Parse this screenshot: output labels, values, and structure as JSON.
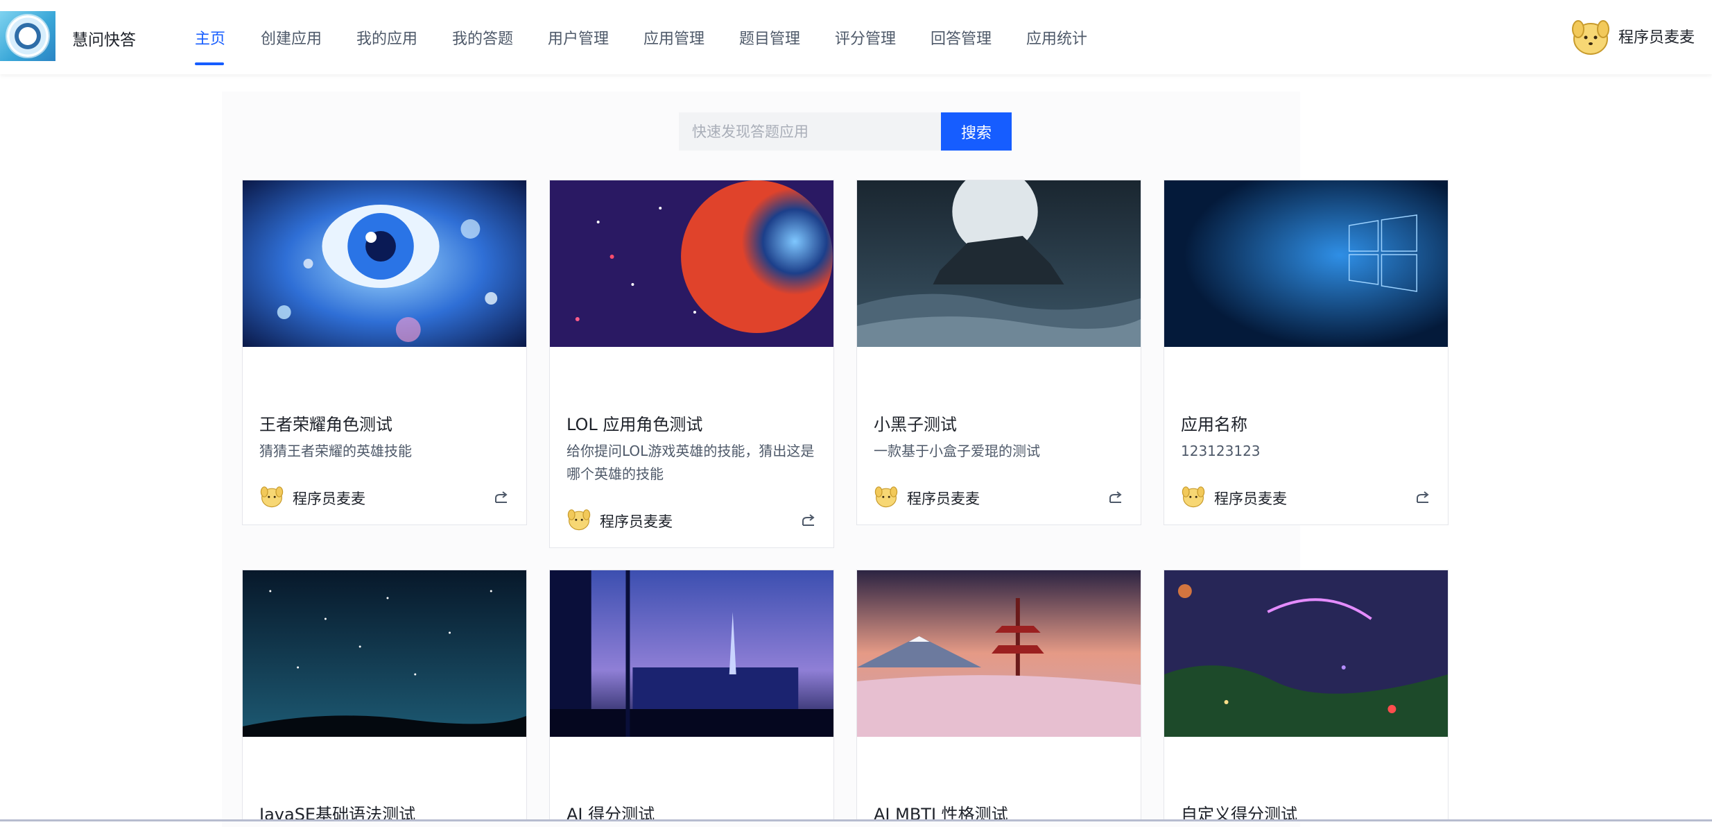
{
  "header": {
    "app_title": "慧问快答",
    "nav": [
      {
        "label": "主页",
        "active": true
      },
      {
        "label": "创建应用"
      },
      {
        "label": "我的应用"
      },
      {
        "label": "我的答题"
      },
      {
        "label": "用户管理"
      },
      {
        "label": "应用管理"
      },
      {
        "label": "题目管理"
      },
      {
        "label": "评分管理"
      },
      {
        "label": "回答管理"
      },
      {
        "label": "应用统计"
      }
    ],
    "user_name": "程序员麦麦",
    "user_avatar_icon": "dog-avatar-icon"
  },
  "search": {
    "placeholder": "快速发现答题应用",
    "value": "",
    "button_label": "搜索"
  },
  "apps": [
    {
      "title": "王者荣耀角色测试",
      "description": "猜猜王者荣耀的英雄技能",
      "author": "程序员麦麦",
      "cover": "anime-eye-image"
    },
    {
      "title": "LOL 应用角色测试",
      "description": "给你提问LOL游戏英雄的技能，猜出这是哪个英雄的技能",
      "author": "程序员麦麦",
      "cover": "planet-space-image"
    },
    {
      "title": "小黑子测试",
      "description": "一款基于小盒子爱琨的测试",
      "author": "程序员麦麦",
      "cover": "moon-island-image"
    },
    {
      "title": "应用名称",
      "description": "123123123",
      "author": "程序员麦麦",
      "cover": "windows-logo-image"
    },
    {
      "title": "JavaSE基础语法测试",
      "description": "",
      "author": "",
      "cover": "starry-night-image"
    },
    {
      "title": "AI 得分测试",
      "description": "",
      "author": "",
      "cover": "city-window-cat-image"
    },
    {
      "title": "AI MBTI 性格测试",
      "description": "",
      "author": "",
      "cover": "fuji-pagoda-image"
    },
    {
      "title": "自定义得分测试",
      "description": "",
      "author": "",
      "cover": "fantasy-forest-image"
    }
  ],
  "colors": {
    "primary": "#165dff",
    "nav_text": "#4e5969",
    "border": "#e5e6eb"
  }
}
